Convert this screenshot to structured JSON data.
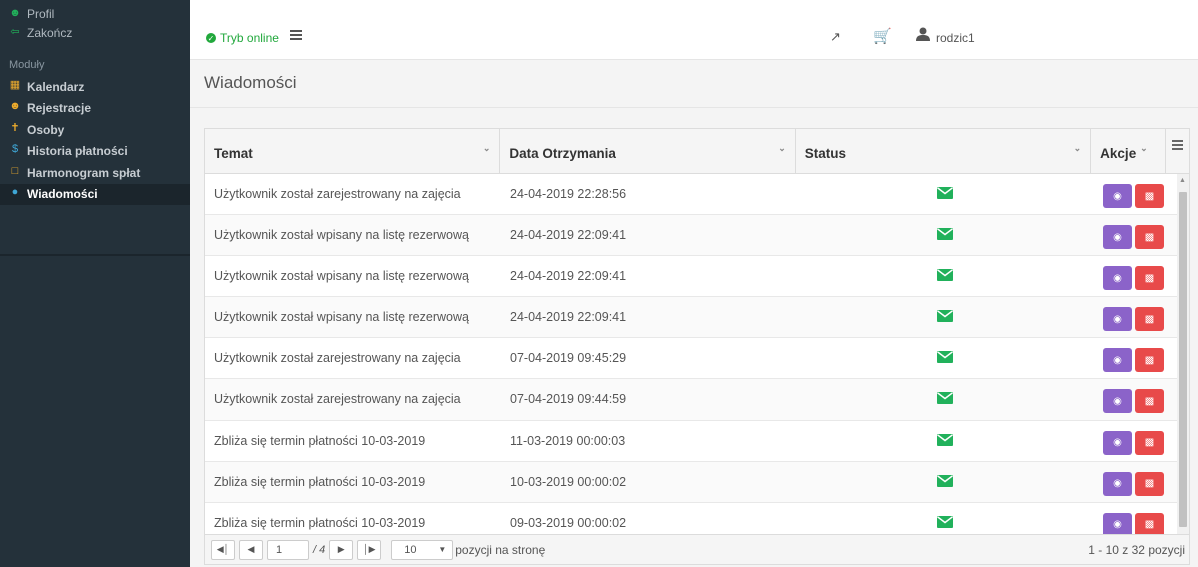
{
  "sidebar": {
    "user_menu": [
      {
        "label": "Profil",
        "icon": "user-icon"
      },
      {
        "label": "Zakończ",
        "icon": "sign-out-icon"
      }
    ],
    "modules_title": "Moduły",
    "modules": [
      {
        "label": "Kalendarz",
        "icon": "calendar-icon"
      },
      {
        "label": "Rejestracje",
        "icon": "users-icon"
      },
      {
        "label": "Osoby",
        "icon": "male-icon"
      },
      {
        "label": "Historia płatności",
        "icon": "dollar-icon"
      },
      {
        "label": "Harmonogram spłat",
        "icon": "calendar-empty-icon"
      },
      {
        "label": "Wiadomości",
        "icon": "comments-icon",
        "active": true
      }
    ]
  },
  "topbar": {
    "status": "Tryb online",
    "username": "rodzic1"
  },
  "page": {
    "title": "Wiadomości"
  },
  "grid": {
    "columns": [
      "Temat",
      "Data Otrzymania",
      "Status",
      "Akcje"
    ],
    "rows": [
      {
        "topic": "Użytkownik został zarejestrowany na zajęcia",
        "date": "24-04-2019 22:28:56",
        "status": "read-envelope"
      },
      {
        "topic": "Użytkownik został wpisany na listę rezerwową",
        "date": "24-04-2019 22:09:41",
        "status": "read-envelope"
      },
      {
        "topic": "Użytkownik został wpisany na listę rezerwową",
        "date": "24-04-2019 22:09:41",
        "status": "read-envelope"
      },
      {
        "topic": "Użytkownik został wpisany na listę rezerwową",
        "date": "24-04-2019 22:09:41",
        "status": "read-envelope"
      },
      {
        "topic": "Użytkownik został zarejestrowany na zajęcia",
        "date": "07-04-2019 09:45:29",
        "status": "read-envelope"
      },
      {
        "topic": "Użytkownik został zarejestrowany na zajęcia",
        "date": "07-04-2019 09:44:59",
        "status": "read-envelope"
      },
      {
        "topic": "Zbliża się termin płatności 10-03-2019",
        "date": "11-03-2019 00:00:03",
        "status": "read-envelope"
      },
      {
        "topic": "Zbliża się termin płatności 10-03-2019",
        "date": "10-03-2019 00:00:02",
        "status": "read-envelope"
      },
      {
        "topic": "Zbliża się termin płatności 10-03-2019",
        "date": "09-03-2019 00:00:02",
        "status": "read-envelope"
      }
    ]
  },
  "pager": {
    "page": "1",
    "of": "/ 4",
    "per_page": "10",
    "per_page_label": "pozycji na stronę",
    "info": "1 - 10 z 32 pozycji"
  },
  "colors": {
    "sidebar_bg": "#24313a",
    "online_green": "#21a83c",
    "status_green": "#21b15b",
    "view_button": "#8b63c9",
    "delete_button": "#e84a4a"
  }
}
